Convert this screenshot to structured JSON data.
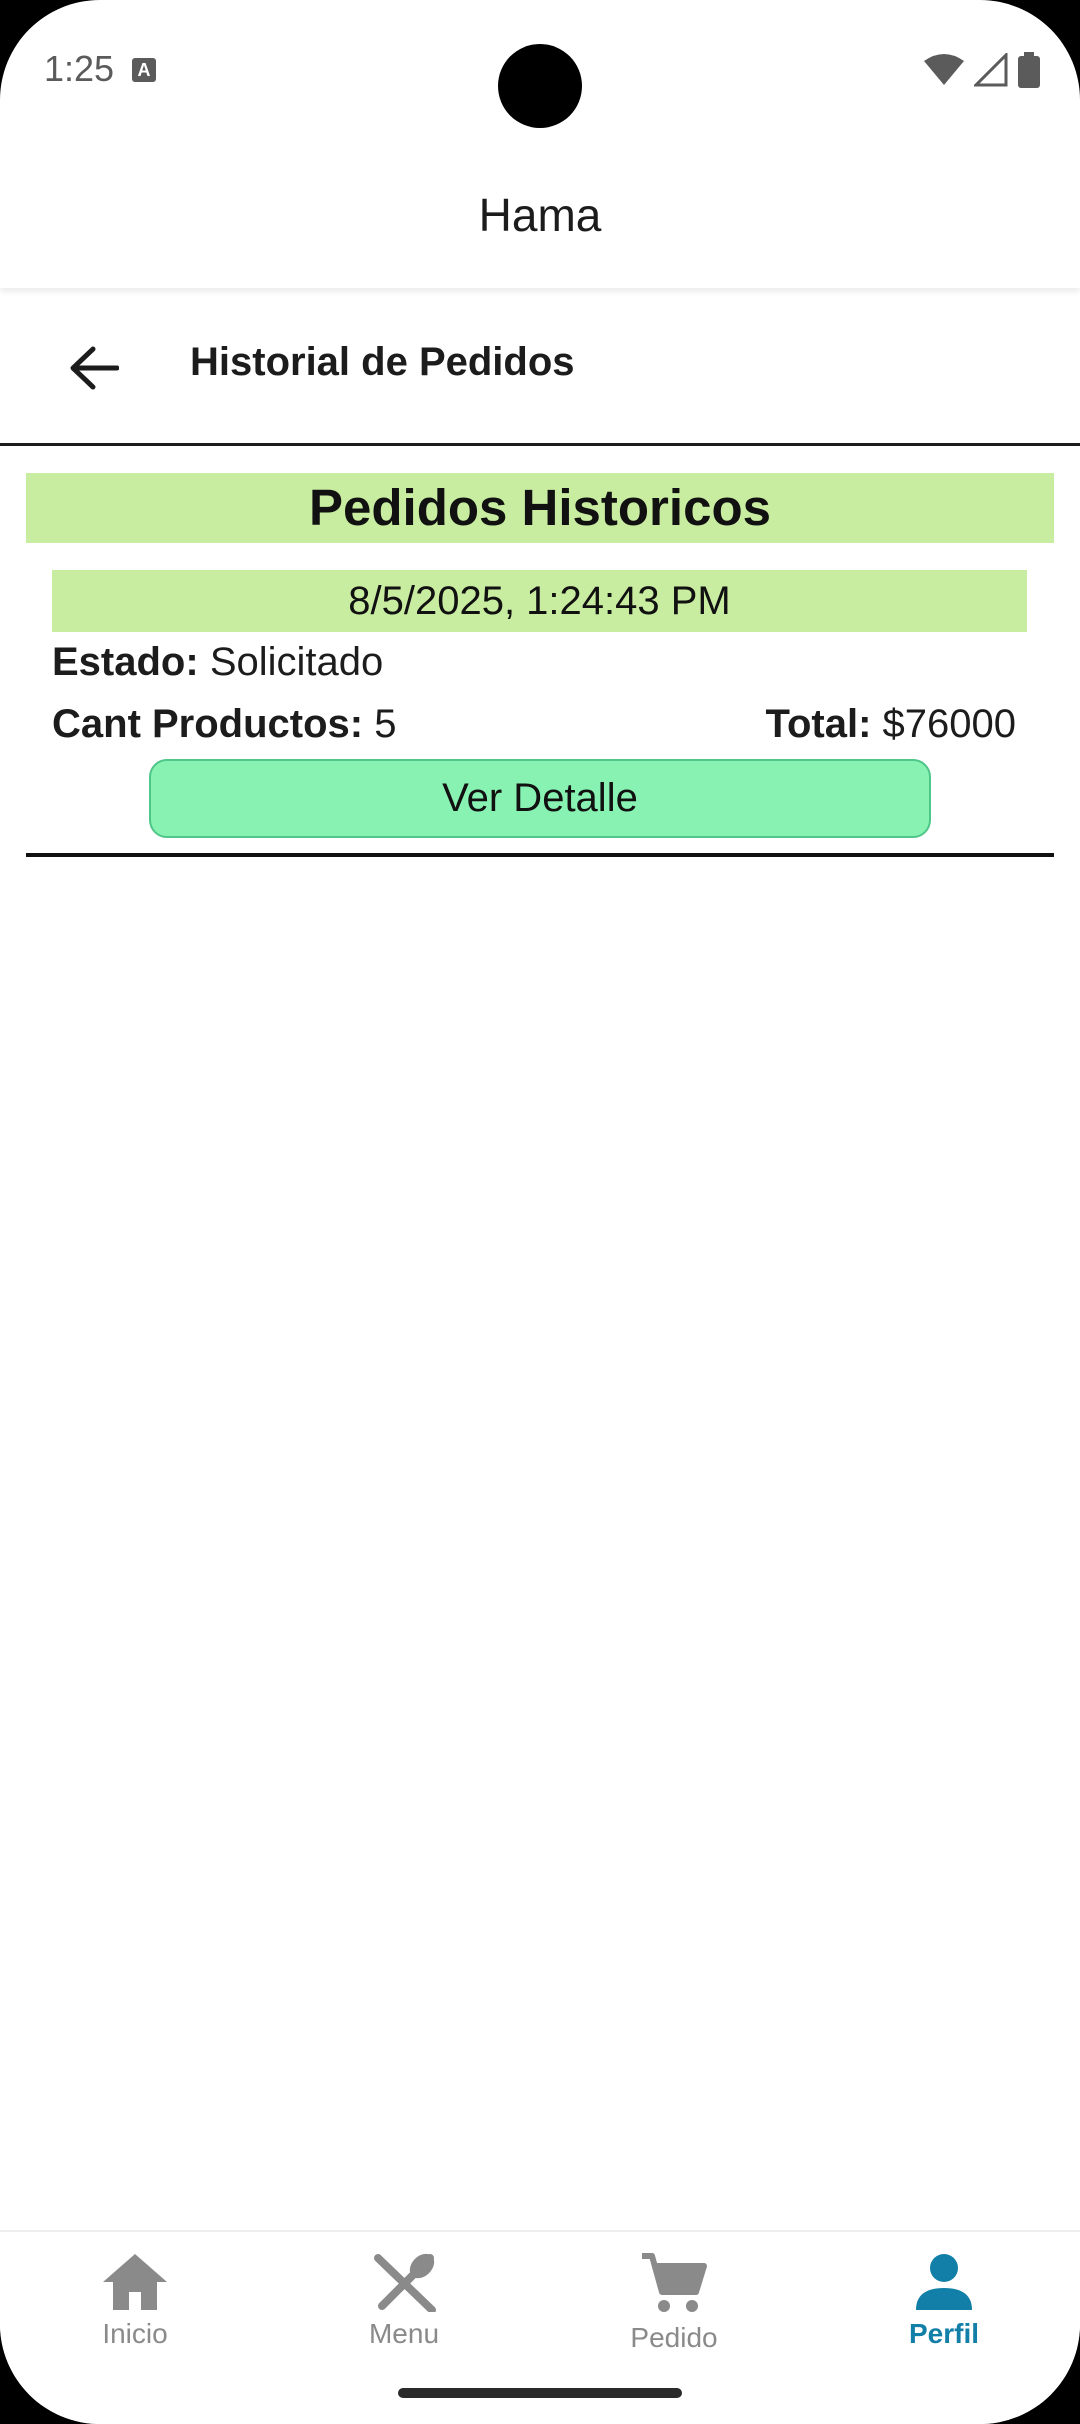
{
  "status_bar": {
    "time": "1:25"
  },
  "header": {
    "title": "Hama"
  },
  "sub_header": {
    "title": "Historial de Pedidos"
  },
  "content": {
    "section_title": "Pedidos Historicos",
    "orders": [
      {
        "date": "8/5/2025, 1:24:43 PM",
        "state_label": "Estado:",
        "state_value": "Solicitado",
        "count_label": "Cant Productos:",
        "count_value": "5",
        "total_label": "Total:",
        "total_value": "$76000",
        "detail_button": "Ver Detalle"
      }
    ]
  },
  "bottom_nav": {
    "items": [
      {
        "label": "Inicio",
        "icon": "home-icon"
      },
      {
        "label": "Menu",
        "icon": "utensils-icon"
      },
      {
        "label": "Pedido",
        "icon": "cart-icon"
      },
      {
        "label": "Perfil",
        "icon": "person-icon",
        "active": true
      }
    ]
  },
  "colors": {
    "accent": "#127fa8",
    "highlight": "#c9eda0",
    "button": "#87f2b2"
  }
}
